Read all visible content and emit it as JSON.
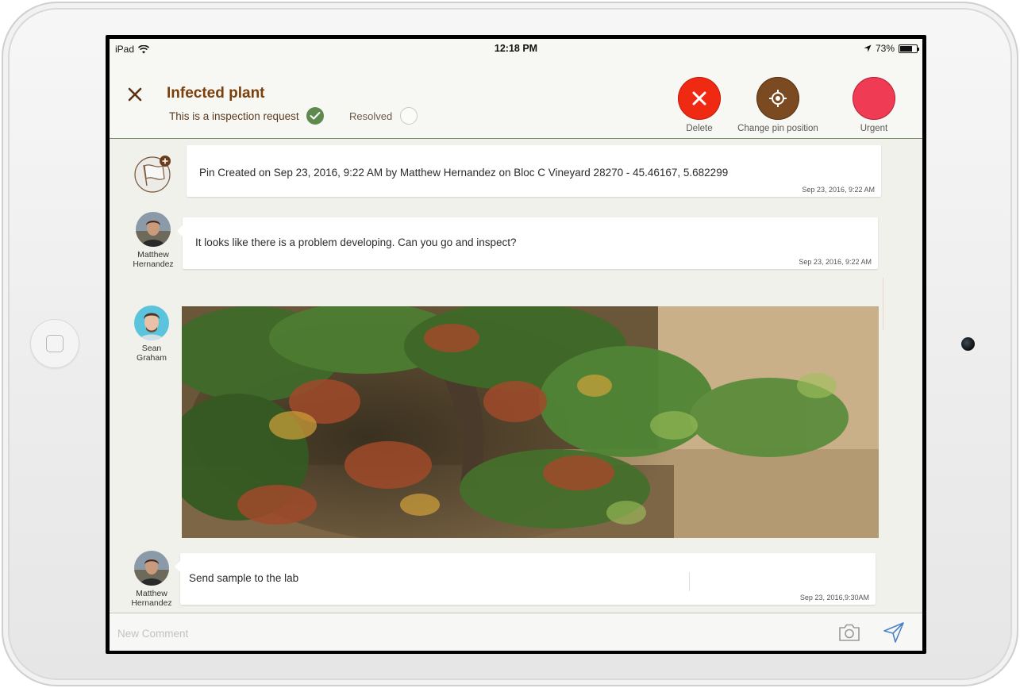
{
  "status_bar": {
    "device": "iPad",
    "time": "12:18 PM",
    "battery": "73%",
    "battery_level": 0.73
  },
  "header": {
    "title": "Infected plant",
    "inspection_label": "This is a inspection request",
    "inspection_checked": true,
    "resolved_label": "Resolved",
    "resolved_checked": false,
    "actions": {
      "delete_label": "Delete",
      "change_pin_label": "Change pin position",
      "urgent_label": "Urgent"
    },
    "colors": {
      "title": "#7a3f0a",
      "delete": "#f02a12",
      "change_pin": "#7b4a21",
      "urgent": "#ef3b53",
      "check": "#5e8a4e"
    }
  },
  "messages": [
    {
      "type": "system",
      "icon": "flag-icon",
      "text_prefix": "Pin Created on Sep 23, 2016, 9:22 AM by ",
      "text_rest": "Matthew Hernandez on Bloc C Vineyard 28270 - 45.46167, 5.682299",
      "time": "Sep 23, 2016, 9:22 AM"
    },
    {
      "type": "text",
      "author_first": "Matthew",
      "author_last": "Hernandez",
      "text": "It looks like there is a problem developing. Can you go and inspect?",
      "time": "Sep 23, 2016, 9:22 AM"
    },
    {
      "type": "photo",
      "author_first": "Sean",
      "author_last": "Graham"
    },
    {
      "type": "text",
      "author_first": "Matthew",
      "author_last": "Hernandez",
      "text": "Send sample to the lab",
      "time": "Sep 23, 2016,9:30AM"
    }
  ],
  "composer": {
    "placeholder": "New Comment",
    "camera_icon": "camera-icon",
    "send_icon": "send-icon"
  }
}
